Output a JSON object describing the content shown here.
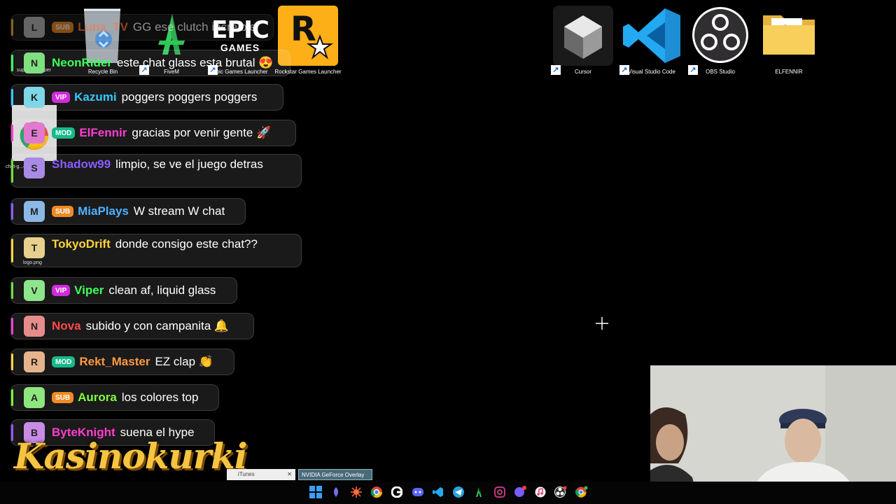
{
  "desktop_icons": [
    {
      "label": "Recycle Bin",
      "icon": "recycle-bin-icon"
    },
    {
      "label": "FiveM",
      "icon": "fivem-icon"
    },
    {
      "label": "Epic Games Launcher",
      "icon": "epic-games-icon",
      "logo_line1": "EPIC",
      "logo_line2": "GAMES"
    },
    {
      "label": "Rockstar Games Launcher",
      "icon": "rockstar-icon",
      "logo": "R"
    },
    {
      "label": "Cursor",
      "icon": "cursor-app-icon"
    },
    {
      "label": "Visual Studio Code",
      "icon": "vscode-icon"
    },
    {
      "label": "OBS Studio",
      "icon": "obs-icon"
    },
    {
      "label": "ELFENNIR",
      "icon": "folder-icon"
    }
  ],
  "desktop_partial_labels": [
    "super-chat...per",
    "chat-g...cb.h...",
    "logo.png"
  ],
  "chat": {
    "messages": [
      {
        "initial": "L",
        "badge": "SUB",
        "user": "Luna_TV",
        "text": "GG ese clutch increible",
        "user_color": "#ff7a3d",
        "avatar_color": "#b9b9b9",
        "bar_color": "#f0b23a",
        "badge_color": "#f08a24"
      },
      {
        "initial": "N",
        "badge": "",
        "user": "NeonRider",
        "text": "este chat glass esta brutal 😍",
        "user_color": "#3dff5a",
        "avatar_color": "#7fe07f",
        "bar_color": "#3dff5a",
        "badge_color": ""
      },
      {
        "initial": "K",
        "badge": "VIP",
        "user": "Kazumi",
        "text": "poggers poggers poggers",
        "user_color": "#35c8ff",
        "avatar_color": "#7fd6e6",
        "bar_color": "#35c8ff",
        "badge_color": "#d02bdc"
      },
      {
        "initial": "E",
        "badge": "MOD",
        "user": "ElFennir",
        "text": "gracias por venir gente 🚀",
        "user_color": "#ff3dd0",
        "avatar_color": "#e07ad0",
        "bar_color": "#ff3dd0",
        "badge_color": "#16b98a"
      },
      {
        "initial": "S",
        "badge": "",
        "user": "Shadow99",
        "text": "limpio, se ve el juego detras",
        "user_color": "#8a5cff",
        "avatar_color": "#a98be6",
        "bar_color": "#6fe03d",
        "badge_color": ""
      },
      {
        "initial": "M",
        "badge": "SUB",
        "user": "MiaPlays",
        "text": "W stream W chat",
        "user_color": "#4db2ff",
        "avatar_color": "#8cb8e6",
        "bar_color": "#8a5cff",
        "badge_color": "#f08a24"
      },
      {
        "initial": "T",
        "badge": "",
        "user": "TokyoDrift",
        "text": "donde consigo este chat??",
        "user_color": "#ffd43d",
        "avatar_color": "#e6d08c",
        "bar_color": "#ffd43d",
        "badge_color": ""
      },
      {
        "initial": "V",
        "badge": "VIP",
        "user": "Viper",
        "text": "clean af, liquid glass",
        "user_color": "#3dff5a",
        "avatar_color": "#8ee68c",
        "bar_color": "#6fe03d",
        "badge_color": "#d02bdc"
      },
      {
        "initial": "N",
        "badge": "",
        "user": "Nova",
        "text": "subido y con campanita 🔔",
        "user_color": "#ff4a4a",
        "avatar_color": "#e68c8c",
        "bar_color": "#ff3dd0",
        "badge_color": ""
      },
      {
        "initial": "R",
        "badge": "MOD",
        "user": "Rekt_Master",
        "text": "EZ clap 👏",
        "user_color": "#ff9a3d",
        "avatar_color": "#e6b48c",
        "bar_color": "#ffd43d",
        "badge_color": "#16b98a"
      },
      {
        "initial": "A",
        "badge": "SUB",
        "user": "Aurora",
        "text": "los colores top",
        "user_color": "#7dff3d",
        "avatar_color": "#8ee67f",
        "bar_color": "#7dff3d",
        "badge_color": "#f08a24"
      },
      {
        "initial": "B",
        "badge": "",
        "user": "ByteKnight",
        "text": "suena el hype",
        "user_color": "#ff3dd0",
        "avatar_color": "#c98ce6",
        "bar_color": "#8a5cff",
        "badge_color": ""
      }
    ]
  },
  "overlay_logo": "Kasinokurki",
  "taskbar": {
    "tooltips": [
      {
        "label": "iTunes",
        "has_close": true
      },
      {
        "label": "NVIDIA GeForce Overlay DT",
        "has_close": false
      }
    ],
    "close_glyph": "✕",
    "apps": [
      {
        "name": "windows-start-icon"
      },
      {
        "name": "edge-dev-icon"
      },
      {
        "name": "settings-sun-icon"
      },
      {
        "name": "chrome-icon"
      },
      {
        "name": "google-icon"
      },
      {
        "name": "discord-icon"
      },
      {
        "name": "vscode-taskbar-icon"
      },
      {
        "name": "telegram-icon"
      },
      {
        "name": "fivem-taskbar-icon"
      },
      {
        "name": "instagram-icon"
      },
      {
        "name": "messenger-icon"
      },
      {
        "name": "itunes-icon"
      },
      {
        "name": "obs-taskbar-icon"
      },
      {
        "name": "chrome-dev-icon"
      }
    ]
  },
  "colors": {
    "accent_vscode": "#23a9f2",
    "folder": "#f7cf5a",
    "rockstar_bg": "#fcaf17"
  }
}
